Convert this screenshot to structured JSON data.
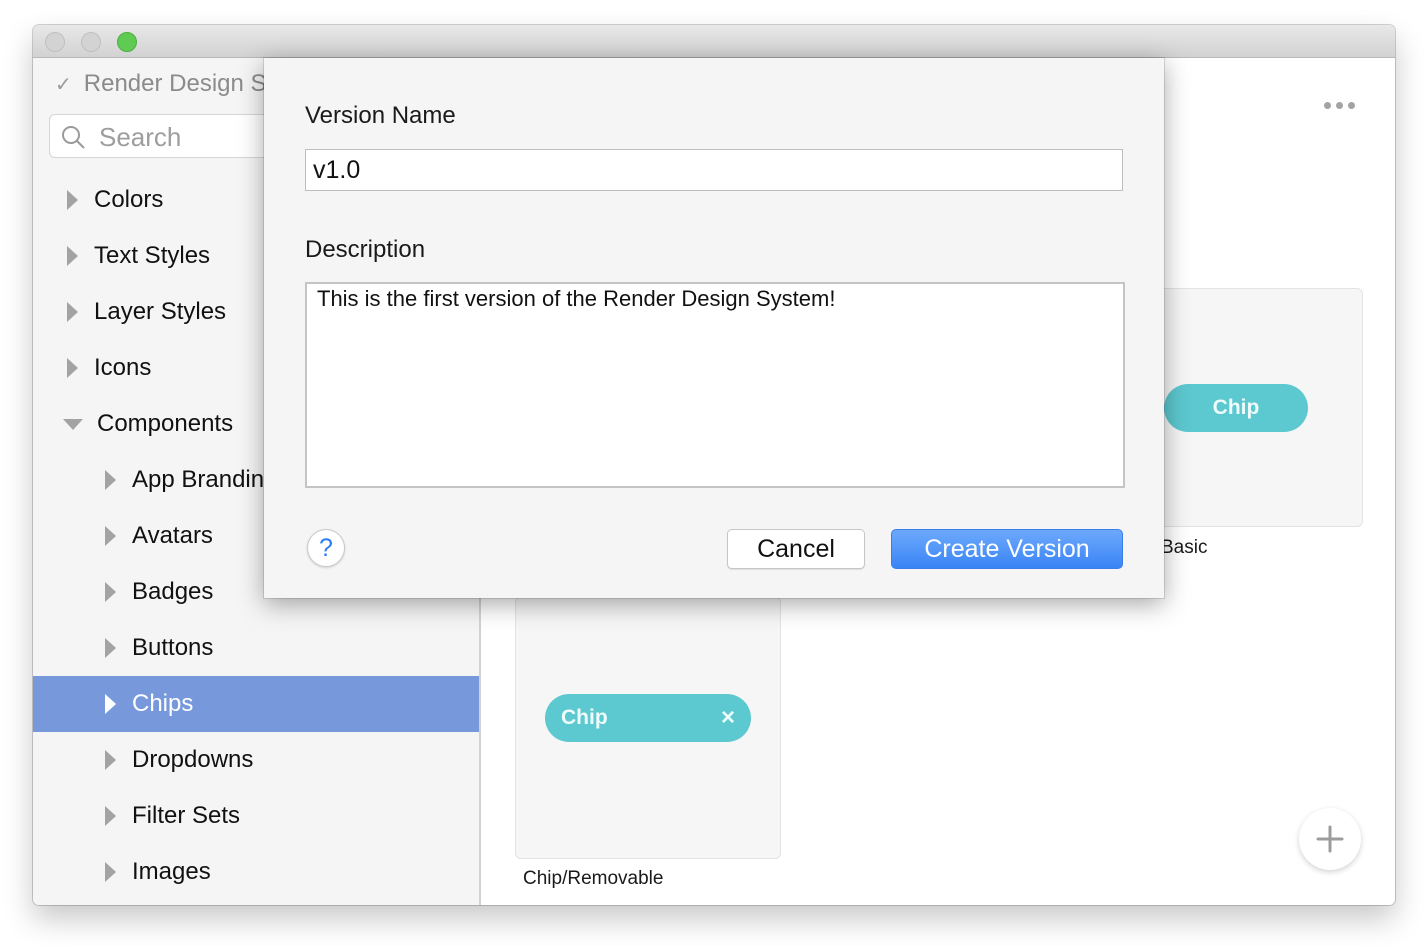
{
  "window": {
    "traffic_lights": [
      "close",
      "minimize",
      "zoom"
    ]
  },
  "sidebar": {
    "library_title": "Render Design System",
    "library_check_icon": "checkmark-icon",
    "search": {
      "placeholder": "Search",
      "icon": "search-icon"
    },
    "items": [
      {
        "label": "Colors",
        "level": 0,
        "expanded": false,
        "selected": false
      },
      {
        "label": "Text Styles",
        "level": 0,
        "expanded": false,
        "selected": false
      },
      {
        "label": "Layer Styles",
        "level": 0,
        "expanded": false,
        "selected": false
      },
      {
        "label": "Icons",
        "level": 0,
        "expanded": false,
        "selected": false
      },
      {
        "label": "Components",
        "level": 0,
        "expanded": true,
        "selected": false
      },
      {
        "label": "App Branding",
        "level": 1,
        "expanded": false,
        "selected": false
      },
      {
        "label": "Avatars",
        "level": 1,
        "expanded": false,
        "selected": false
      },
      {
        "label": "Badges",
        "level": 1,
        "expanded": false,
        "selected": false
      },
      {
        "label": "Buttons",
        "level": 1,
        "expanded": false,
        "selected": false
      },
      {
        "label": "Chips",
        "level": 1,
        "expanded": false,
        "selected": true
      },
      {
        "label": "Dropdowns",
        "level": 1,
        "expanded": false,
        "selected": false
      },
      {
        "label": "Filter Sets",
        "level": 1,
        "expanded": false,
        "selected": false
      },
      {
        "label": "Images",
        "level": 1,
        "expanded": false,
        "selected": false
      }
    ]
  },
  "content": {
    "more_icon": "more-horizontal-icon",
    "cards": [
      {
        "name": "Chip/Basic",
        "visible_label": "Basic",
        "chip_label": "Chip",
        "removable": false
      },
      {
        "name": "Chip/Removable",
        "visible_label": "Chip/Removable",
        "chip_label": "Chip",
        "removable": true,
        "remove_glyph": "×"
      }
    ],
    "add_button_glyph": "+"
  },
  "dialog": {
    "version_name_label": "Version Name",
    "version_name_value": "v1.0",
    "description_label": "Description",
    "description_value": "This is the first version of the Render Design System!",
    "help_glyph": "?",
    "cancel_label": "Cancel",
    "create_label": "Create Version"
  },
  "colors": {
    "selection": "#7799dc",
    "chip": "#5cc8cf",
    "primary_button": "#3a84f6",
    "help_accent": "#2d7cf6",
    "zoom_light": "#5fcb52"
  }
}
